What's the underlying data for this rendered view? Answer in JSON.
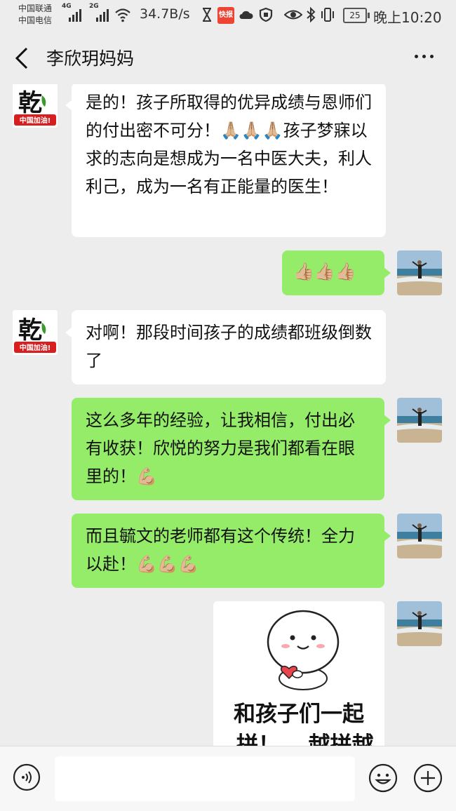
{
  "status_bar": {
    "carrier1": "中国联通",
    "carrier2": "中国电信",
    "net1": "4G",
    "net2": "2G",
    "speed": "34.7B/s",
    "kuaibao": "快报",
    "battery": "25",
    "time": "晚上10:20"
  },
  "header": {
    "title": "李欣玥妈妈"
  },
  "messages": [
    {
      "side": "in",
      "text": "是的！孩子所取得的优异成绩与恩师们的付出密不可分！🙏🏼🙏🏼🙏🏼孩子梦寐以求的志向是想成为一名中医大夫，利人利己，成为一名有正能量的医生！"
    },
    {
      "side": "out",
      "text": "👍🏼👍🏼👍🏼"
    },
    {
      "side": "in",
      "text": "对啊！那段时间孩子的成绩都班级倒数了"
    },
    {
      "side": "out",
      "text": "这么多年的经验，让我相信，付出必有收获！欣悦的努力是我们都看在眼里的！💪🏼"
    },
    {
      "side": "out",
      "text": "而且毓文的老师都有这个传统！全力以赴！💪🏼💪🏼💪🏼"
    }
  ],
  "sticker": {
    "line1": "和孩子们一起",
    "line2": "拼！",
    "line3": "越拼越"
  },
  "contact_avatar": {
    "char": "乾",
    "badge": "中国加油!"
  },
  "colors": {
    "outgoing_bubble": "#95ec69",
    "incoming_bubble": "#ffffff",
    "background": "#ededed"
  }
}
